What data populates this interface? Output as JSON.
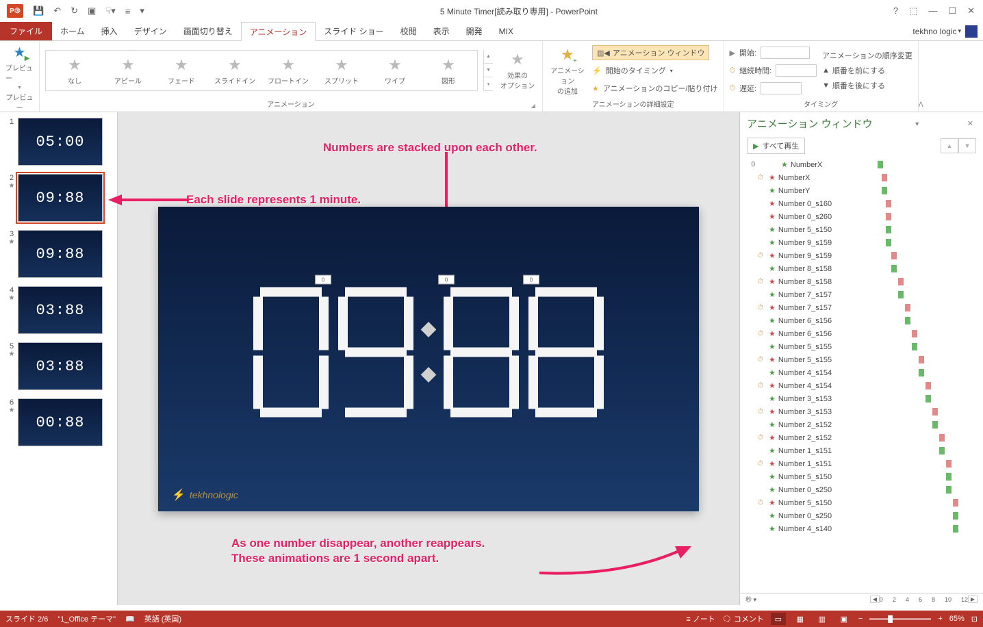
{
  "window": {
    "title": "5 Minute Timer[読み取り専用] - PowerPoint",
    "user": "tekhno logic"
  },
  "tabs": {
    "file": "ファイル",
    "items": [
      "ホーム",
      "挿入",
      "デザイン",
      "画面切り替え",
      "アニメーション",
      "スライド ショー",
      "校閲",
      "表示",
      "開発",
      "MIX"
    ],
    "active_index": 4
  },
  "ribbon": {
    "preview": "プレビュー",
    "preview_group": "プレビュー",
    "gallery": [
      "なし",
      "アピール",
      "フェード",
      "スライドイン",
      "フロートイン",
      "スプリット",
      "ワイプ",
      "図形"
    ],
    "animation_group": "アニメーション",
    "effect_options": "効果の\nオプション",
    "add_animation": "アニメーション\nの追加",
    "anim_pane_btn": "アニメーション ウィンドウ",
    "trigger": "開始のタイミング",
    "painter": "アニメーションのコピー/貼り付け",
    "advanced_group": "アニメーションの詳細設定",
    "start_label": "開始:",
    "duration_label": "継続時間:",
    "delay_label": "遅延:",
    "reorder_header": "アニメーションの順序変更",
    "move_earlier": "順番を前にする",
    "move_later": "順番を後にする",
    "timing_group": "タイミング"
  },
  "thumbnails": [
    {
      "num": "1",
      "text": "05:00",
      "has_anim": false
    },
    {
      "num": "2",
      "text": "09:88",
      "has_anim": true,
      "selected": true
    },
    {
      "num": "3",
      "text": "09:88",
      "has_anim": true
    },
    {
      "num": "4",
      "text": "03:88",
      "has_anim": true
    },
    {
      "num": "5",
      "text": "03:88",
      "has_anim": true
    },
    {
      "num": "6",
      "text": "00:88",
      "has_anim": true
    }
  ],
  "slide": {
    "handles": [
      "0",
      "0",
      "0"
    ],
    "logo": "tekhnologic"
  },
  "annotations": {
    "a1": "Numbers are stacked upon each other.",
    "a2": "Each slide represents 1 minute.",
    "a3a": "As one number disappear, another reappears.",
    "a3b": "These animations are 1 second apart."
  },
  "anim_pane": {
    "title": "アニメーション ウィンドウ",
    "play_all": "すべて再生",
    "group_num": "0",
    "items": [
      {
        "clock": "",
        "star": "green",
        "label": "NumberX",
        "pos": 10,
        "bar": "green",
        "tri": true
      },
      {
        "clock": "⏱",
        "star": "red",
        "label": "NumberX",
        "pos": 16,
        "bar": "red",
        "tri": true
      },
      {
        "clock": "",
        "star": "green",
        "label": "NumberY",
        "pos": 16,
        "bar": "green",
        "tri": true
      },
      {
        "clock": "",
        "star": "red",
        "label": "Number 0_s160",
        "pos": 22,
        "bar": "red",
        "tri": true
      },
      {
        "clock": "",
        "star": "red",
        "label": "Number 0_s260",
        "pos": 22,
        "bar": "red",
        "tri": true
      },
      {
        "clock": "",
        "star": "green",
        "label": "Number 5_s150",
        "pos": 22,
        "bar": "green",
        "tri": true
      },
      {
        "clock": "",
        "star": "green",
        "label": "Number 9_s159",
        "pos": 22,
        "bar": "green",
        "tri": true
      },
      {
        "clock": "⏱",
        "star": "red",
        "label": "Number 9_s159",
        "pos": 30,
        "bar": "red",
        "tri": true
      },
      {
        "clock": "",
        "star": "green",
        "label": "Number 8_s158",
        "pos": 30,
        "bar": "green",
        "tri": true
      },
      {
        "clock": "⏱",
        "star": "red",
        "label": "Number 8_s158",
        "pos": 40,
        "bar": "red",
        "tri": true
      },
      {
        "clock": "",
        "star": "green",
        "label": "Number 7_s157",
        "pos": 40,
        "bar": "green",
        "tri": true
      },
      {
        "clock": "⏱",
        "star": "red",
        "label": "Number 7_s157",
        "pos": 50,
        "bar": "red",
        "tri": true
      },
      {
        "clock": "",
        "star": "green",
        "label": "Number 6_s156",
        "pos": 50,
        "bar": "green",
        "tri": true
      },
      {
        "clock": "⏱",
        "star": "red",
        "label": "Number 6_s156",
        "pos": 60,
        "bar": "red",
        "tri": true
      },
      {
        "clock": "",
        "star": "green",
        "label": "Number 5_s155",
        "pos": 60,
        "bar": "green",
        "tri": true
      },
      {
        "clock": "⏱",
        "star": "red",
        "label": "Number 5_s155",
        "pos": 70,
        "bar": "red",
        "tri": true
      },
      {
        "clock": "",
        "star": "green",
        "label": "Number 4_s154",
        "pos": 70,
        "bar": "green",
        "tri": true
      },
      {
        "clock": "⏱",
        "star": "red",
        "label": "Number 4_s154",
        "pos": 80,
        "bar": "red",
        "tri": true
      },
      {
        "clock": "",
        "star": "green",
        "label": "Number 3_s153",
        "pos": 80,
        "bar": "green",
        "tri": true
      },
      {
        "clock": "⏱",
        "star": "red",
        "label": "Number 3_s153",
        "pos": 90,
        "bar": "red",
        "tri": true
      },
      {
        "clock": "",
        "star": "green",
        "label": "Number 2_s152",
        "pos": 90,
        "bar": "green",
        "tri": true
      },
      {
        "clock": "⏱",
        "star": "red",
        "label": "Number 2_s152",
        "pos": 100,
        "bar": "red",
        "tri": true
      },
      {
        "clock": "",
        "star": "green",
        "label": "Number 1_s151",
        "pos": 100,
        "bar": "green",
        "tri": true
      },
      {
        "clock": "⏱",
        "star": "red",
        "label": "Number 1_s151",
        "pos": 110,
        "bar": "red",
        "tri": true
      },
      {
        "clock": "",
        "star": "green",
        "label": "Number 5_s150",
        "pos": 110,
        "bar": "green",
        "tri": true
      },
      {
        "clock": "",
        "star": "green",
        "label": "Number 0_s250",
        "pos": 110,
        "bar": "green",
        "tri": true
      },
      {
        "clock": "⏱",
        "star": "red",
        "label": "Number 5_s150",
        "pos": 120,
        "bar": "red",
        "tri": true
      },
      {
        "clock": "",
        "star": "green",
        "label": "Number 0_s250",
        "pos": 120,
        "bar": "green",
        "tri": true
      },
      {
        "clock": "",
        "star": "green",
        "label": "Number 4_s140",
        "pos": 120,
        "bar": "green",
        "tri": true
      }
    ],
    "ruler_unit": "秒",
    "ruler_ticks": [
      "0",
      "2",
      "4",
      "6",
      "8",
      "10",
      "12"
    ]
  },
  "statusbar": {
    "slide_info": "スライド 2/6",
    "theme": "\"1_Office テーマ\"",
    "lang": "英語 (英国)",
    "notes": "ノート",
    "comments": "コメント",
    "zoom": "65%"
  }
}
